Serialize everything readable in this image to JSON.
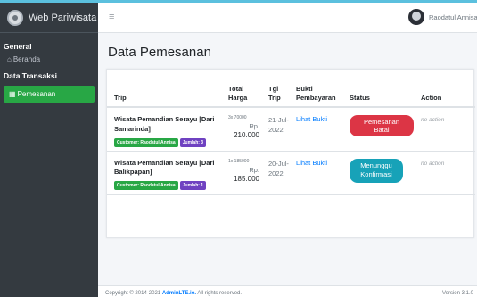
{
  "sidebar": {
    "brand": "Web Pariwisata",
    "sections": [
      {
        "header": "General",
        "items": [
          {
            "label": "Beranda",
            "icon": "home-icon"
          }
        ]
      },
      {
        "header": "Data Transaksi",
        "items": [
          {
            "label": "Pemesanan",
            "icon": "table-icon",
            "active": true
          }
        ]
      }
    ]
  },
  "navbar": {
    "menu_icon": "hamburger-icon",
    "user_name": "Raodatul Annisa"
  },
  "page": {
    "title": "Data Pemesanan"
  },
  "table": {
    "headers": {
      "trip": "Trip",
      "harga_1": "Total",
      "harga_2": "Harga",
      "tgl": "Tgl Trip",
      "bukti_1": "Bukti",
      "bukti_2": "Pembayaran",
      "status": "Status",
      "action": "Action"
    },
    "rows": [
      {
        "trip_1": "Wisata Pemandian Serayu [Dari",
        "trip_2": "Samarinda]",
        "customer": "Customer: Raodatul Annisa",
        "jumlah": "Jumlah: 3",
        "harga_small": "3x 70000",
        "rp": "Rp.",
        "total": "210.000",
        "tgl_1": "21-Jul-",
        "tgl_2": "2022",
        "bukti": "Lihat Bukti",
        "status": "Pemesanan Batal",
        "action": "no action"
      },
      {
        "trip_1": "Wisata Pemandian Serayu [Dari",
        "trip_2": "Balikpapan]",
        "customer": "Customer: Raodatul Annisa",
        "jumlah": "Jumlah: 1",
        "harga_small": "1x 185000",
        "rp": "Rp.",
        "total": "185.000",
        "tgl_1": "20-Jul-",
        "tgl_2": "2022",
        "bukti": "Lihat Bukti",
        "status_1": "Menunggu",
        "status_2": "Konfirmasi",
        "action": "no action"
      }
    ]
  },
  "footer": {
    "copyright": "Copyright © 2014-2021",
    "brand": "AdminLTE.io.",
    "rights": "All rights reserved.",
    "version": "Version 3.1.0"
  }
}
